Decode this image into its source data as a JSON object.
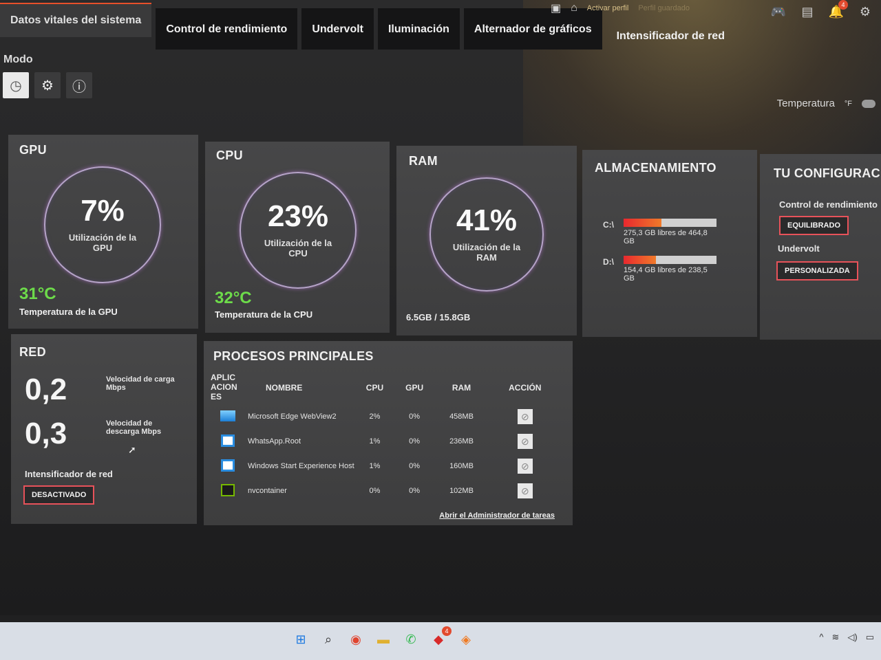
{
  "tabs": [
    {
      "label": "Datos vitales del sistema",
      "active": true
    },
    {
      "label": "Control de rendimiento"
    },
    {
      "label": "Undervolt"
    },
    {
      "label": "Iluminación"
    },
    {
      "label": "Alternador de gráficos"
    },
    {
      "label": "Intensificador de red"
    }
  ],
  "topbar": {
    "activate_profile": "Activar perfil",
    "profile_faded": "Perfil guardado"
  },
  "mode": {
    "label": "Modo"
  },
  "temperature": {
    "label": "Temperatura",
    "unit": "°F"
  },
  "gpu": {
    "title": "GPU",
    "percent": "7%",
    "usage_label": "Utilización de la GPU",
    "temp": "31°C",
    "temp_label": "Temperatura de la GPU"
  },
  "cpu": {
    "title": "CPU",
    "percent": "23%",
    "usage_label": "Utilización de la CPU",
    "temp": "32°C",
    "temp_label": "Temperatura de la CPU"
  },
  "ram": {
    "title": "RAM",
    "percent": "41%",
    "usage_label": "Utilización de la RAM",
    "amount": "6.5GB / 15.8GB"
  },
  "storage": {
    "title": "ALMACENAMIENTO",
    "drives": [
      {
        "letter": "C:\\",
        "info": "275,3 GB libres de 464,8 GB",
        "used_fraction": 0.41
      },
      {
        "letter": "D:\\",
        "info": "154,4 GB libres de 238,5 GB",
        "used_fraction": 0.35
      }
    ]
  },
  "config": {
    "title": "TU CONFIGURACI",
    "perf_label": "Control de rendimiento",
    "perf_value": "EQUILIBRADO",
    "undervolt_label": "Undervolt",
    "undervolt_value": "PERSONALIZADA"
  },
  "network": {
    "title": "RED",
    "upload_value": "0,2",
    "upload_label": "Velocidad de carga Mbps",
    "download_value": "0,3",
    "download_label": "Velocidad de descarga Mbps",
    "boost_label": "Intensificador de red",
    "boost_value": "DESACTIVADO"
  },
  "processes": {
    "title": "PROCESOS PRINCIPALES",
    "columns": {
      "app": "APLIC ACION ES",
      "name": "NOMBRE",
      "cpu": "CPU",
      "gpu": "GPU",
      "ram": "RAM",
      "action": "ACCIÓN"
    },
    "rows": [
      {
        "name": "Microsoft Edge WebView2",
        "cpu": "2%",
        "gpu": "0%",
        "ram": "458MB",
        "icon": "edge-webview-icon"
      },
      {
        "name": "WhatsApp.Root",
        "cpu": "1%",
        "gpu": "0%",
        "ram": "236MB",
        "icon": "window-app-icon"
      },
      {
        "name": "Windows Start Experience Host",
        "cpu": "1%",
        "gpu": "0%",
        "ram": "160MB",
        "icon": "window-app-icon"
      },
      {
        "name": "nvcontainer",
        "cpu": "0%",
        "gpu": "0%",
        "ram": "102MB",
        "icon": "nvidia-icon"
      }
    ],
    "link": "Abrir el Administrador de tareas"
  },
  "notifications": {
    "count": "4"
  },
  "taskbar_badge": "4",
  "colors": {
    "accent": "#e8502a",
    "temp_green": "#6ddb4a",
    "button_border": "#e8525a"
  }
}
